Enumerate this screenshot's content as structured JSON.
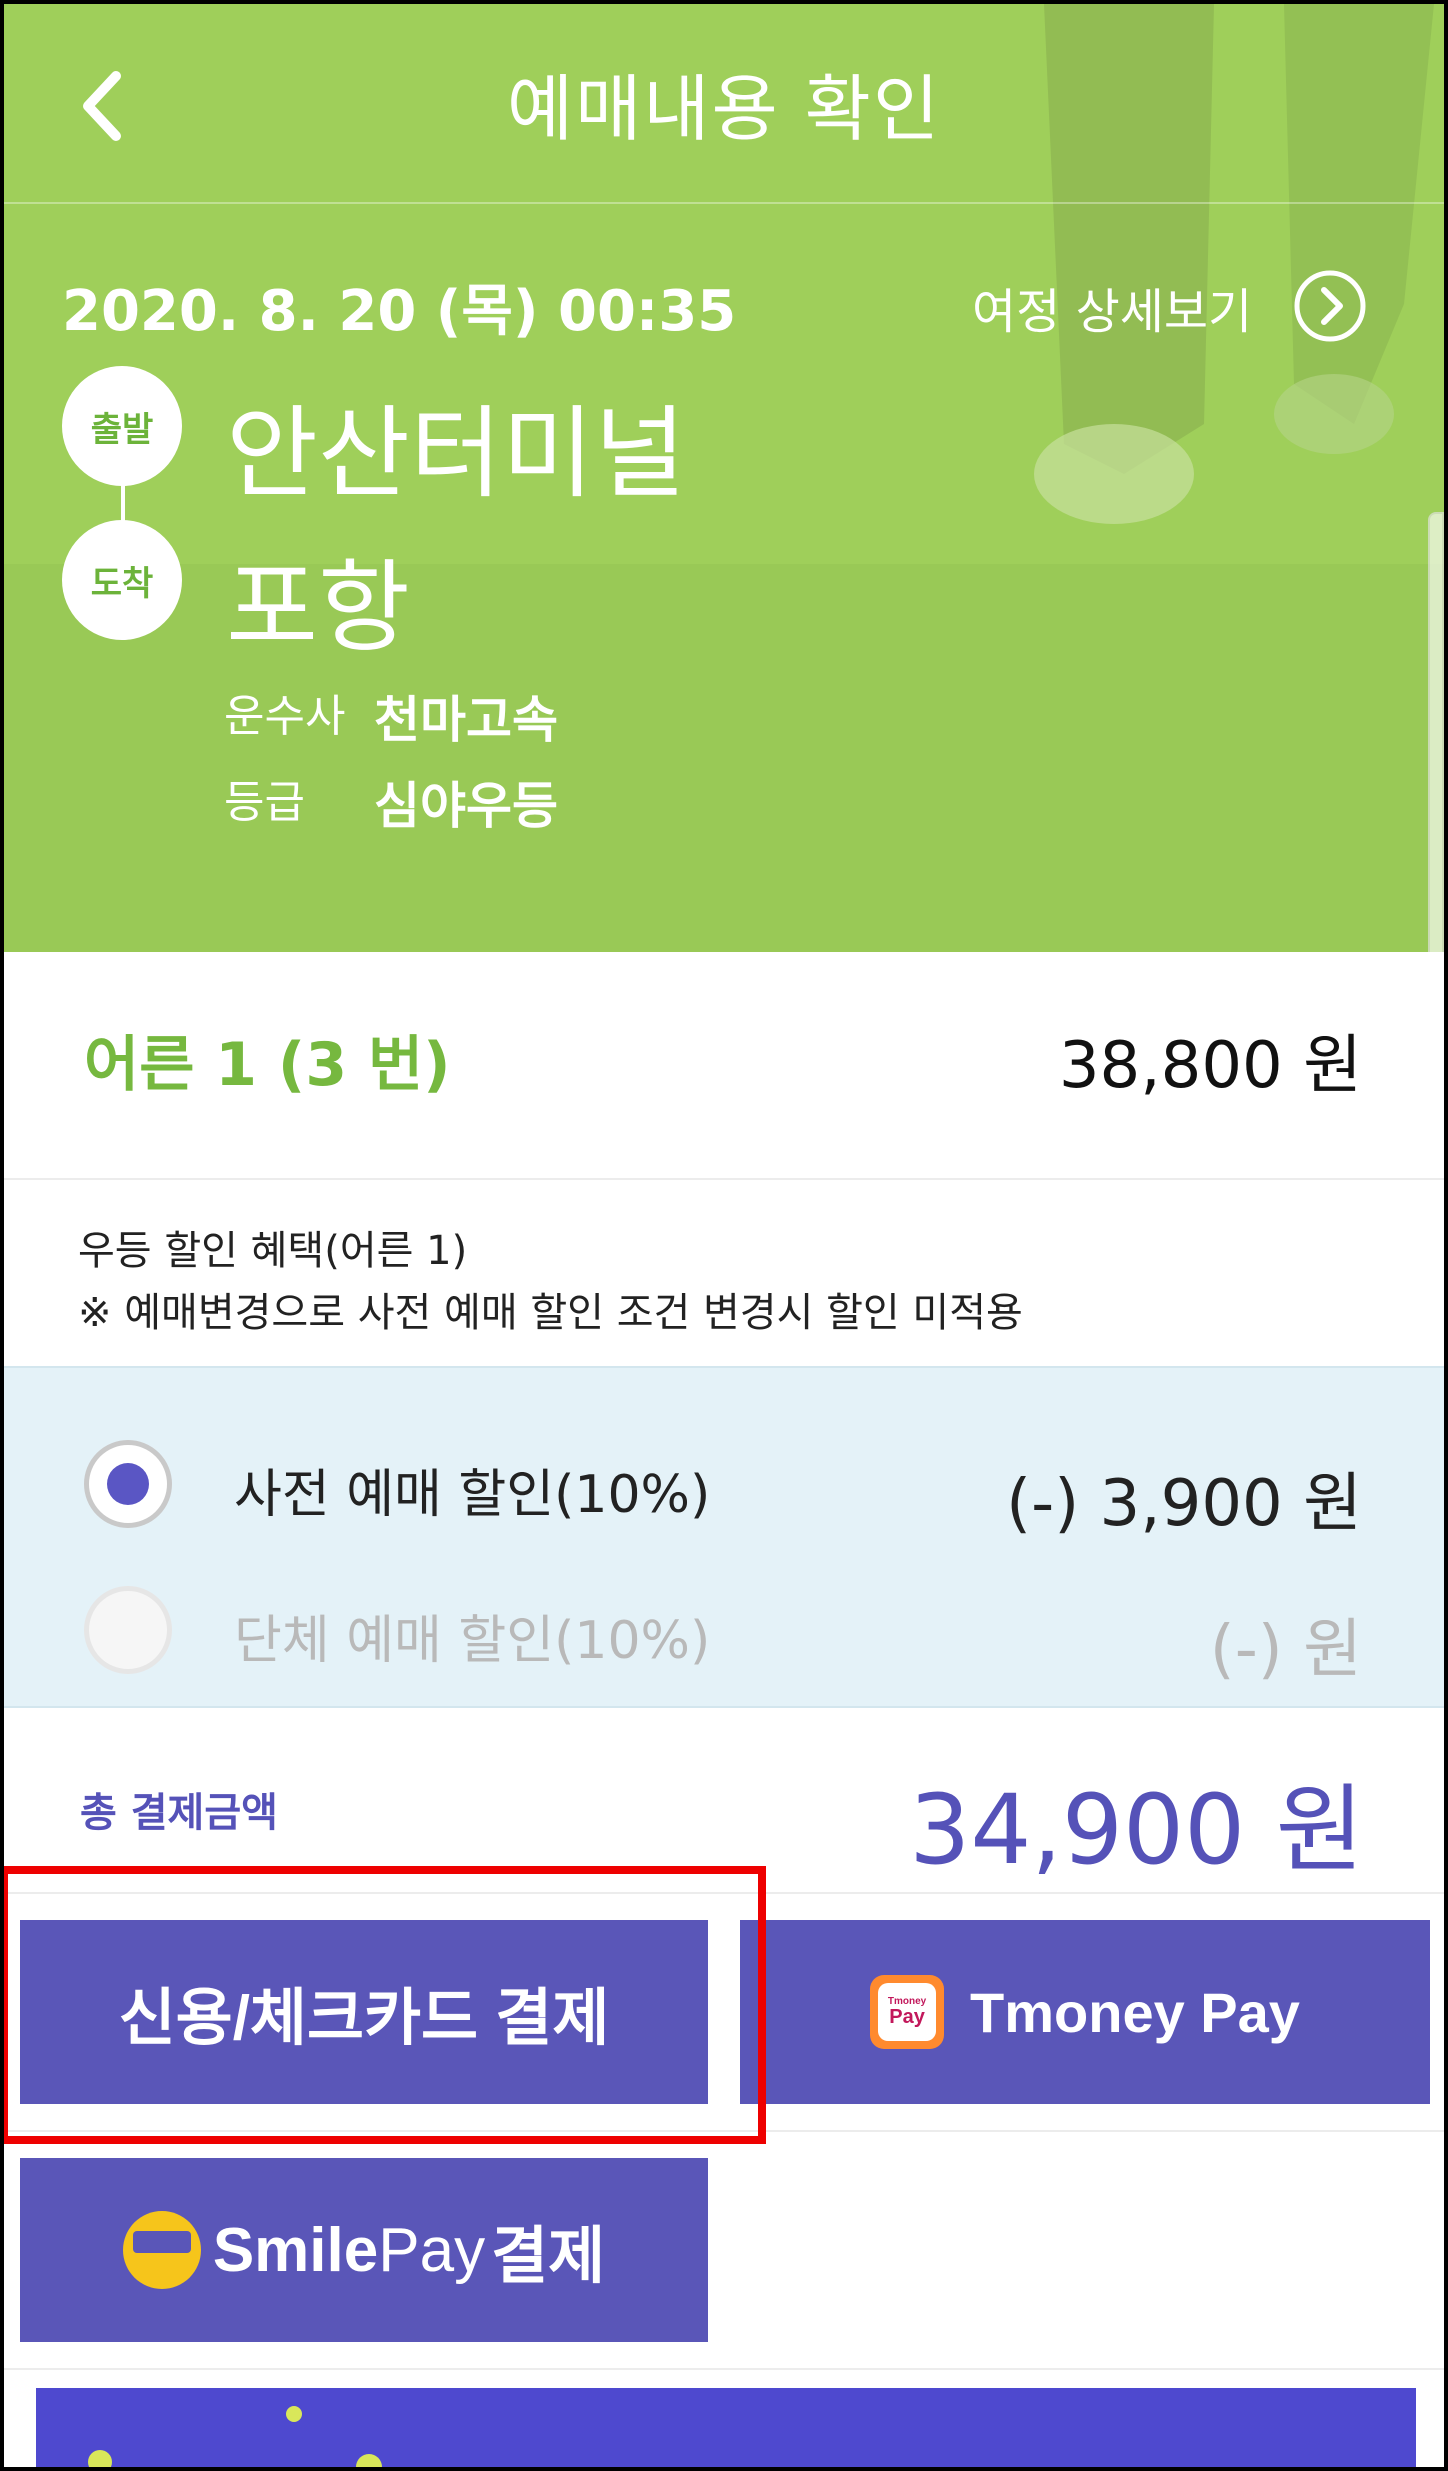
{
  "header": {
    "title": "예매내용 확인",
    "back_icon": "chevron-left-icon"
  },
  "trip": {
    "datetime": "2020. 8. 20 (목) 00:35",
    "detail_link": "여정 상세보기",
    "departure_badge": "출발",
    "departure_name": "안산터미널",
    "arrival_badge": "도착",
    "arrival_name": "포항",
    "company_label": "운수사",
    "company_value": "천마고속",
    "grade_label": "등급",
    "grade_value": "심야우등"
  },
  "fare": {
    "label": "어른 1 (3 번)",
    "amount": "38,800 원"
  },
  "notice": {
    "line1": "우등 할인 혜택(어른 1)",
    "line2": "※ 예매변경으로 사전 예매 할인 조건 변경시 할인 미적용"
  },
  "discounts": [
    {
      "label": "사전 예매 할인(10%)",
      "amount": "(-) 3,900 원",
      "selected": true,
      "enabled": true
    },
    {
      "label": "단체 예매 할인(10%)",
      "amount": "(-) 원",
      "selected": false,
      "enabled": false
    }
  ],
  "total": {
    "label": "총 결제금액",
    "amount": "34,900 원"
  },
  "payment": {
    "card_label": "신용/체크카드 결제",
    "tmoney_logo_small": "Tmoney",
    "tmoney_logo_big": "Pay",
    "tmoney_label": "Tmoney Pay",
    "smile_word": "Smile",
    "smile_pay_word": "Pay",
    "smile_suffix": "결제"
  },
  "colors": {
    "accent_green": "#76b83f",
    "accent_purple": "#5a56b8",
    "highlight_red": "#ee0000",
    "discount_bg": "#e4f2f8"
  }
}
